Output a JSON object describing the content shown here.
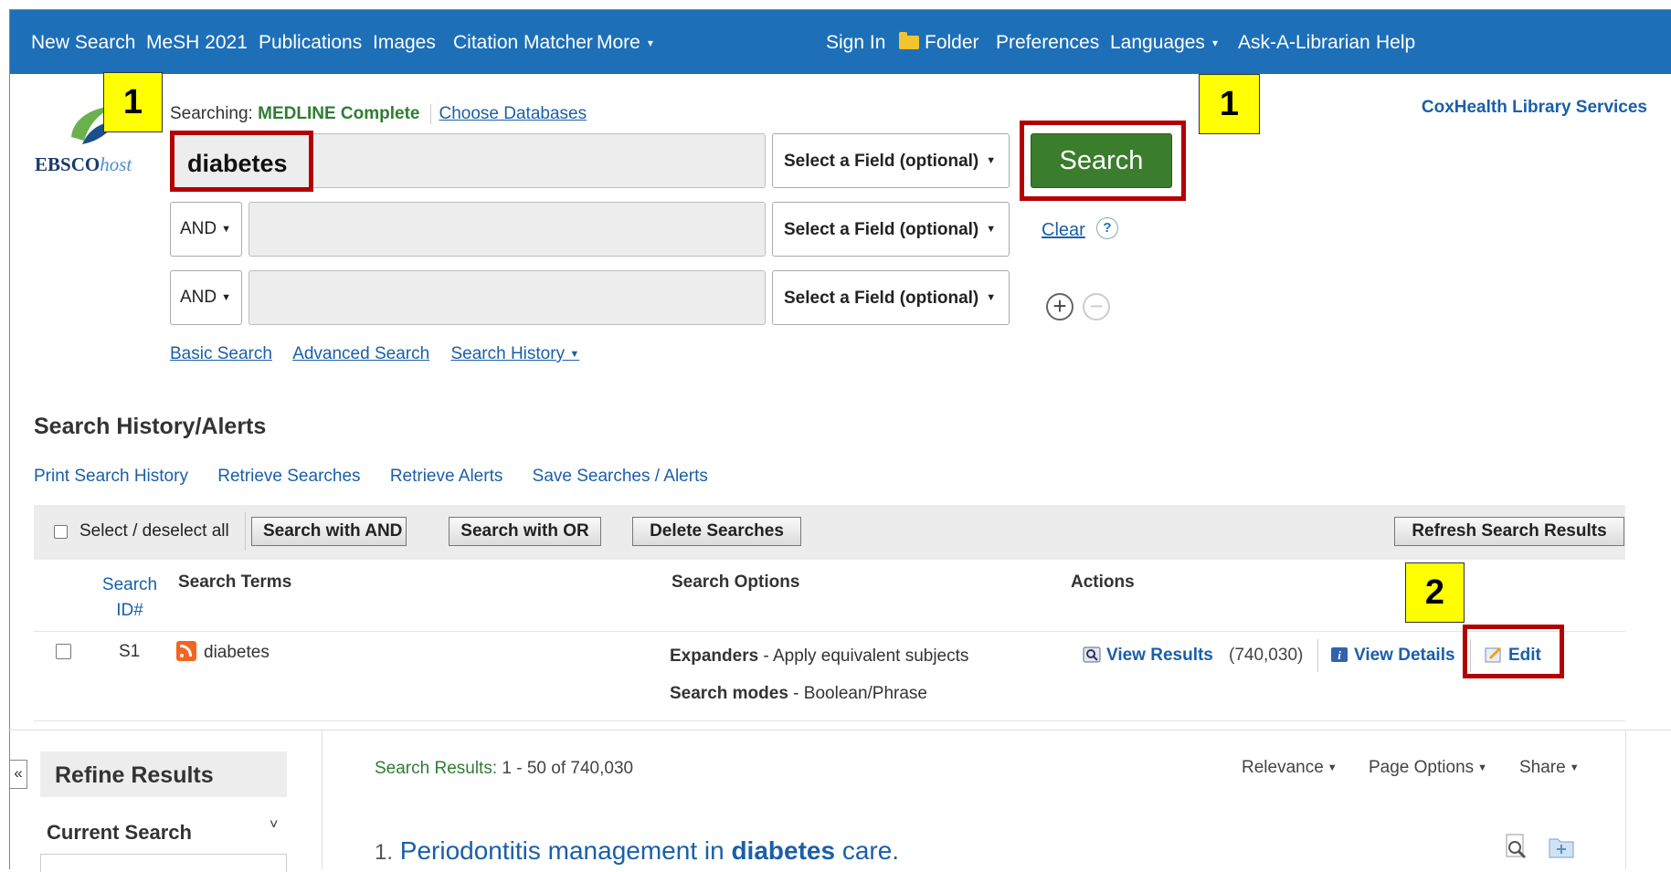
{
  "nav": {
    "left": [
      "New Search",
      "MeSH 2021",
      "Publications",
      "Images",
      "Citation Matcher",
      "More"
    ],
    "right": [
      "Sign In",
      "Folder",
      "Preferences",
      "Languages",
      "Ask-A-Librarian",
      "Help"
    ]
  },
  "brand": {
    "logo_main": "EBSCO",
    "logo_sub": "host",
    "library": "CoxHealth Library Services"
  },
  "search": {
    "searching_label": "Searching:",
    "database": "MEDLINE Complete",
    "choose_db": "Choose Databases",
    "term1": "diabetes",
    "field_select": "Select a Field (optional)",
    "bool1": "AND",
    "bool2": "AND",
    "search_button": "Search",
    "clear": "Clear",
    "help": "?",
    "plus": "+",
    "minus": "−",
    "links": [
      "Basic Search",
      "Advanced Search",
      "Search History"
    ]
  },
  "badges": {
    "b1a": "1",
    "b1b": "1",
    "b2": "2"
  },
  "history": {
    "title": "Search History/Alerts",
    "links": [
      "Print Search History",
      "Retrieve Searches",
      "Retrieve Alerts",
      "Save Searches / Alerts"
    ],
    "select_all": "Select / deselect all",
    "btn_and": "Search with AND",
    "btn_or": "Search with OR",
    "btn_delete": "Delete Searches",
    "btn_refresh": "Refresh Search Results",
    "col_id_1": "Search",
    "col_id_2": "ID#",
    "col_terms": "Search Terms",
    "col_options": "Search Options",
    "col_actions": "Actions",
    "row": {
      "id": "S1",
      "term": "diabetes",
      "expanders_label": "Expanders",
      "expanders_val": " - Apply equivalent subjects",
      "modes_label": "Search modes",
      "modes_val": " - Boolean/Phrase",
      "view_results": "View Results",
      "count": "(740,030)",
      "view_details": "View Details",
      "edit": "Edit"
    }
  },
  "results": {
    "collapse": "«",
    "refine": "Refine Results",
    "current_search": "Current Search",
    "count_label": "Search Results:",
    "count_val": " 1 - 50 of 740,030",
    "sort": "Relevance",
    "page_options": "Page Options",
    "share": "Share",
    "item_num": "1.",
    "item_title_pre": "Periodontitis management in ",
    "item_title_hl": "diabetes",
    "item_title_post": " care."
  }
}
